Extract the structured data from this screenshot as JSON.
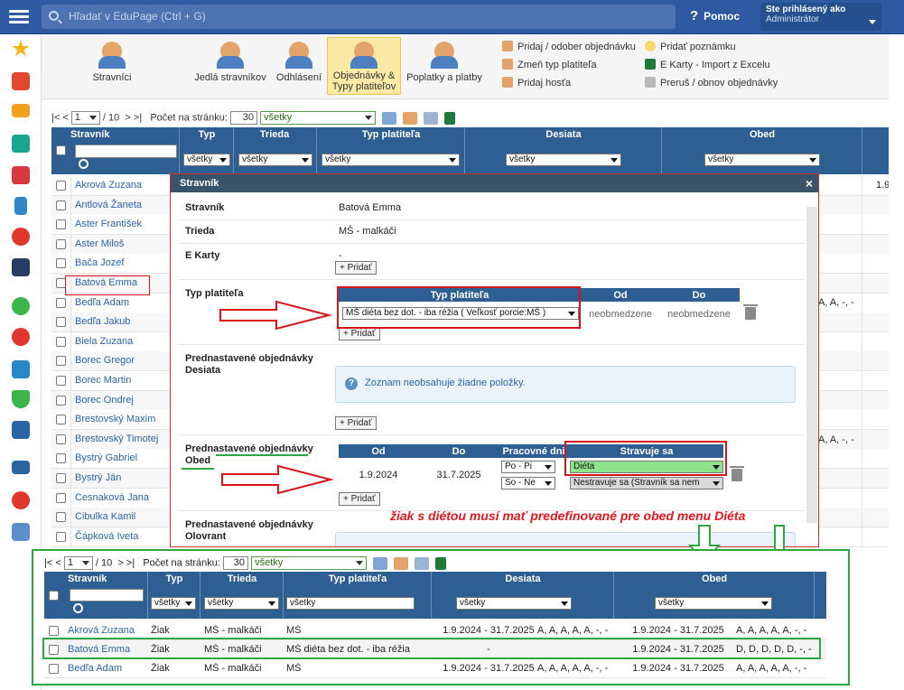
{
  "topbar": {
    "search_placeholder": "Hľadať v EduPage (Ctrl + G)",
    "help_label": "Pomoc",
    "user_line1": "Ste prihlásený ako",
    "user_line2": "Administrátor"
  },
  "toolbar": {
    "buttons": [
      "Stravníci",
      "Jedlá stravníkov",
      "Odhlásení",
      "Objednávky & Typy platiteľov",
      "Poplatky a platby"
    ],
    "active_button": "Objednávky & Typy platiteľov",
    "links_col1": [
      "Pridaj / odober objednávku",
      "Zmeň typ platiteľa",
      "Pridaj hosťa"
    ],
    "links_col2": [
      "Pridať poznámku",
      "E Karty - Import z Excelu",
      "Preruš / obnov objednávky"
    ]
  },
  "pager": {
    "first": "|<",
    "prev": "<",
    "page": "1",
    "of": "/ 10",
    "next": ">",
    "last": ">|",
    "per_page_label": "Počet na stránku:",
    "per_page": "30",
    "filter": "všetky"
  },
  "table": {
    "headers": [
      "Stravník",
      "Typ",
      "Trieda",
      "Typ platiteľa",
      "Desiata",
      "Obed"
    ],
    "filters": {
      "typ": "všetky",
      "trieda": "všetky",
      "platitel": "všetky",
      "desiata": "všetky",
      "obed": "všetky"
    },
    "names": [
      "Akrová Zuzana",
      "Antlová Žaneta",
      "Aster František",
      "Aster Miloš",
      "Bača Jozef",
      "Batová Emma",
      "Bedľa Adam",
      "Bedľa Jakub",
      "Biela Zuzana",
      "Borec Gregor",
      "Borec Martin",
      "Borec Ondrej",
      "Brestovský Maxim",
      "Brestovský Timotej",
      "Bystrý Gabriel",
      "Bystrý Ján",
      "Cesnaková Jana",
      "Cibulka Kamil",
      "Čápková Iveta"
    ],
    "right_fragments": [
      {
        "row": 0,
        "text": "1.9"
      },
      {
        "row": 6,
        "text": "A, A, -, -"
      },
      {
        "row": 13,
        "text": "A, A, -, -"
      }
    ]
  },
  "modal": {
    "title": "Stravník",
    "close": "×",
    "stravnik_label": "Stravník",
    "stravnik_value": "Batová Emma",
    "trieda_label": "Trieda",
    "trieda_value": "MŠ - malkáči",
    "ekarty_label": "E Karty",
    "ekarty_value": "-",
    "add_label": "+ Pridať",
    "typ_label": "Typ platiteľa",
    "typ_table": {
      "headers": [
        "Typ platiteľa",
        "Od",
        "Do"
      ],
      "select": "MŠ diéta bez dot. - iba réžia ( Veľkosť porcie:MŠ )",
      "od": "neobmedzene",
      "do": "neobmedzene"
    },
    "desiata_label_1": "Prednastavené objednávky",
    "desiata_label_2": "Desiata",
    "empty_list": "Zoznam neobsahuje žiadne položky.",
    "obed_label_1": "Prednastavené objednávky",
    "obed_label_2": "Obed",
    "obed_table": {
      "headers": [
        "Od",
        "Do",
        "Pracovné dni",
        "Stravuje sa"
      ],
      "od": "1.9.2024",
      "do": "31.7.2025",
      "day1": "Po - Pi",
      "day2": "So - Ne",
      "strav1": "Diéta",
      "strav2": "Nestravuje sa (Stravník sa nem"
    },
    "olovrant_label_1": "Prednastavené objednávky",
    "olovrant_label_2": "Olovrant"
  },
  "annotation": "žiak s diétou musí mať predefinované pre obed menu Diéta",
  "inset": {
    "rows": [
      {
        "name": "Akrová Zuzana",
        "typ": "Žiak",
        "trieda": "MŠ - malkáči",
        "platitel": "MŠ",
        "desiata_range": "1.9.2024 - 31.7.2025",
        "desiata_days": "A, A, A, A, A, -, -",
        "obed_range": "1.9.2024 - 31.7.2025",
        "obed_days": "A, A, A, A, A, -, -"
      },
      {
        "name": "Batová Emma",
        "typ": "Žiak",
        "trieda": "MŠ - malkáči",
        "platitel": "MŠ diéta bez dot. - iba réžia",
        "desiata_range": "-",
        "desiata_days": "",
        "obed_range": "1.9.2024 - 31.7.2025",
        "obed_days": "D, D, D, D, D, -, -"
      },
      {
        "name": "Bedľa Adam",
        "typ": "Žiak",
        "trieda": "MŠ - malkáči",
        "platitel": "MŠ",
        "desiata_range": "1.9.2024 - 31.7.2025",
        "desiata_days": "A, A, A, A, A, -, -",
        "obed_range": "1.9.2024 - 31.7.2025",
        "obed_days": "A, A, A, A, A, -, -"
      }
    ]
  },
  "colors": {
    "topbar": "#2d5aa0",
    "header": "#2e5f93",
    "highlight_red": "#d9141b",
    "highlight_green": "#2fa843",
    "active_tab": "#fde9a6"
  }
}
